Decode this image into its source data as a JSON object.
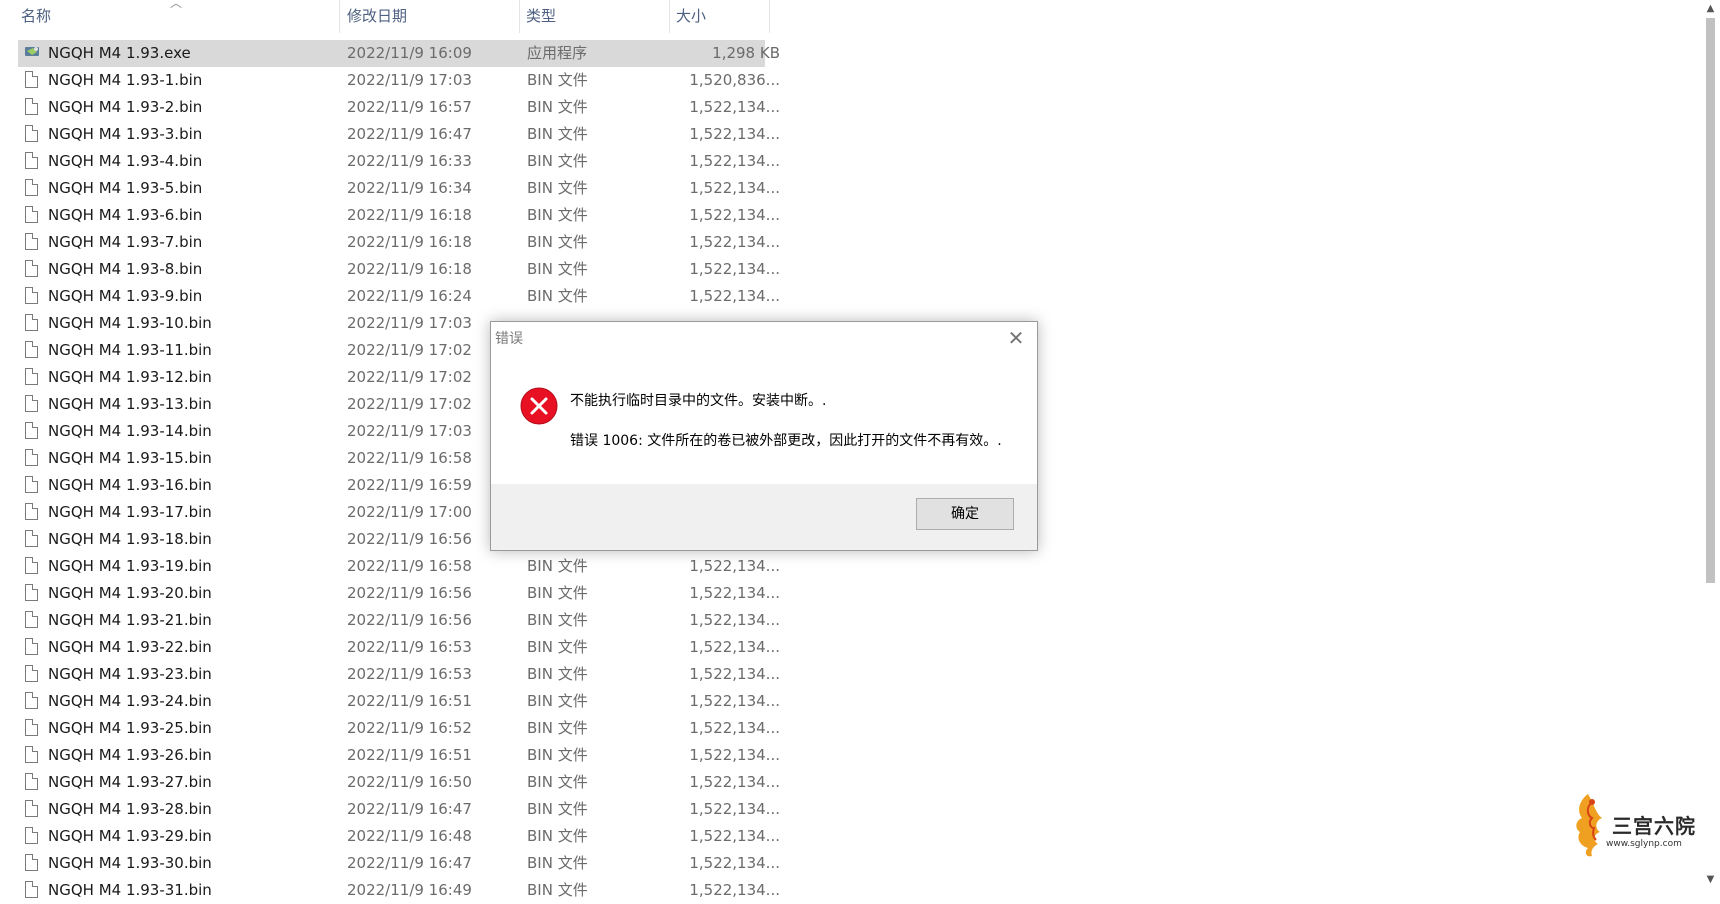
{
  "columns": {
    "name": "名称",
    "date": "修改日期",
    "type": "类型",
    "size": "大小"
  },
  "files": [
    {
      "name": "NGQH M4 1.93.exe",
      "date": "2022/11/9 16:09",
      "type": "应用程序",
      "size": "1,298 KB",
      "icon": "exe-icon"
    },
    {
      "name": "NGQH M4 1.93-1.bin",
      "date": "2022/11/9 17:03",
      "type": "BIN 文件",
      "size": "1,520,836...",
      "icon": "file-icon"
    },
    {
      "name": "NGQH M4 1.93-2.bin",
      "date": "2022/11/9 16:57",
      "type": "BIN 文件",
      "size": "1,522,134...",
      "icon": "file-icon"
    },
    {
      "name": "NGQH M4 1.93-3.bin",
      "date": "2022/11/9 16:47",
      "type": "BIN 文件",
      "size": "1,522,134...",
      "icon": "file-icon"
    },
    {
      "name": "NGQH M4 1.93-4.bin",
      "date": "2022/11/9 16:33",
      "type": "BIN 文件",
      "size": "1,522,134...",
      "icon": "file-icon"
    },
    {
      "name": "NGQH M4 1.93-5.bin",
      "date": "2022/11/9 16:34",
      "type": "BIN 文件",
      "size": "1,522,134...",
      "icon": "file-icon"
    },
    {
      "name": "NGQH M4 1.93-6.bin",
      "date": "2022/11/9 16:18",
      "type": "BIN 文件",
      "size": "1,522,134...",
      "icon": "file-icon"
    },
    {
      "name": "NGQH M4 1.93-7.bin",
      "date": "2022/11/9 16:18",
      "type": "BIN 文件",
      "size": "1,522,134...",
      "icon": "file-icon"
    },
    {
      "name": "NGQH M4 1.93-8.bin",
      "date": "2022/11/9 16:18",
      "type": "BIN 文件",
      "size": "1,522,134...",
      "icon": "file-icon"
    },
    {
      "name": "NGQH M4 1.93-9.bin",
      "date": "2022/11/9 16:24",
      "type": "BIN 文件",
      "size": "1,522,134...",
      "icon": "file-icon"
    },
    {
      "name": "NGQH M4 1.93-10.bin",
      "date": "2022/11/9 17:03",
      "type": "",
      "size": "",
      "icon": "file-icon"
    },
    {
      "name": "NGQH M4 1.93-11.bin",
      "date": "2022/11/9 17:02",
      "type": "",
      "size": "",
      "icon": "file-icon"
    },
    {
      "name": "NGQH M4 1.93-12.bin",
      "date": "2022/11/9 17:02",
      "type": "",
      "size": "",
      "icon": "file-icon"
    },
    {
      "name": "NGQH M4 1.93-13.bin",
      "date": "2022/11/9 17:02",
      "type": "",
      "size": "",
      "icon": "file-icon"
    },
    {
      "name": "NGQH M4 1.93-14.bin",
      "date": "2022/11/9 17:03",
      "type": "",
      "size": "",
      "icon": "file-icon"
    },
    {
      "name": "NGQH M4 1.93-15.bin",
      "date": "2022/11/9 16:58",
      "type": "",
      "size": "",
      "icon": "file-icon"
    },
    {
      "name": "NGQH M4 1.93-16.bin",
      "date": "2022/11/9 16:59",
      "type": "",
      "size": "",
      "icon": "file-icon"
    },
    {
      "name": "NGQH M4 1.93-17.bin",
      "date": "2022/11/9 17:00",
      "type": "",
      "size": "",
      "icon": "file-icon"
    },
    {
      "name": "NGQH M4 1.93-18.bin",
      "date": "2022/11/9 16:56",
      "type": "",
      "size": "",
      "icon": "file-icon"
    },
    {
      "name": "NGQH M4 1.93-19.bin",
      "date": "2022/11/9 16:58",
      "type": "BIN 文件",
      "size": "1,522,134...",
      "icon": "file-icon"
    },
    {
      "name": "NGQH M4 1.93-20.bin",
      "date": "2022/11/9 16:56",
      "type": "BIN 文件",
      "size": "1,522,134...",
      "icon": "file-icon"
    },
    {
      "name": "NGQH M4 1.93-21.bin",
      "date": "2022/11/9 16:56",
      "type": "BIN 文件",
      "size": "1,522,134...",
      "icon": "file-icon"
    },
    {
      "name": "NGQH M4 1.93-22.bin",
      "date": "2022/11/9 16:53",
      "type": "BIN 文件",
      "size": "1,522,134...",
      "icon": "file-icon"
    },
    {
      "name": "NGQH M4 1.93-23.bin",
      "date": "2022/11/9 16:53",
      "type": "BIN 文件",
      "size": "1,522,134...",
      "icon": "file-icon"
    },
    {
      "name": "NGQH M4 1.93-24.bin",
      "date": "2022/11/9 16:51",
      "type": "BIN 文件",
      "size": "1,522,134...",
      "icon": "file-icon"
    },
    {
      "name": "NGQH M4 1.93-25.bin",
      "date": "2022/11/9 16:52",
      "type": "BIN 文件",
      "size": "1,522,134...",
      "icon": "file-icon"
    },
    {
      "name": "NGQH M4 1.93-26.bin",
      "date": "2022/11/9 16:51",
      "type": "BIN 文件",
      "size": "1,522,134...",
      "icon": "file-icon"
    },
    {
      "name": "NGQH M4 1.93-27.bin",
      "date": "2022/11/9 16:50",
      "type": "BIN 文件",
      "size": "1,522,134...",
      "icon": "file-icon"
    },
    {
      "name": "NGQH M4 1.93-28.bin",
      "date": "2022/11/9 16:47",
      "type": "BIN 文件",
      "size": "1,522,134...",
      "icon": "file-icon"
    },
    {
      "name": "NGQH M4 1.93-29.bin",
      "date": "2022/11/9 16:48",
      "type": "BIN 文件",
      "size": "1,522,134...",
      "icon": "file-icon"
    },
    {
      "name": "NGQH M4 1.93-30.bin",
      "date": "2022/11/9 16:47",
      "type": "BIN 文件",
      "size": "1,522,134...",
      "icon": "file-icon"
    },
    {
      "name": "NGQH M4 1.93-31.bin",
      "date": "2022/11/9 16:49",
      "type": "BIN 文件",
      "size": "1,522,134...",
      "icon": "file-icon"
    }
  ],
  "dialog": {
    "title": "错误",
    "close_glyph": "✕",
    "icon": "error-icon",
    "message": "不能执行临时目录中的文件。安装中断。.",
    "detail": "错误 1006: 文件所在的卷已被外部更改，因此打开的文件不再有效。.",
    "ok_label": "确定"
  },
  "watermark": {
    "text": "三宫六院",
    "url": "www.sglynp.com"
  },
  "colors": {
    "selected_row": "#d9d9d9",
    "header_text": "#4d6082",
    "error_red": "#e81123"
  }
}
